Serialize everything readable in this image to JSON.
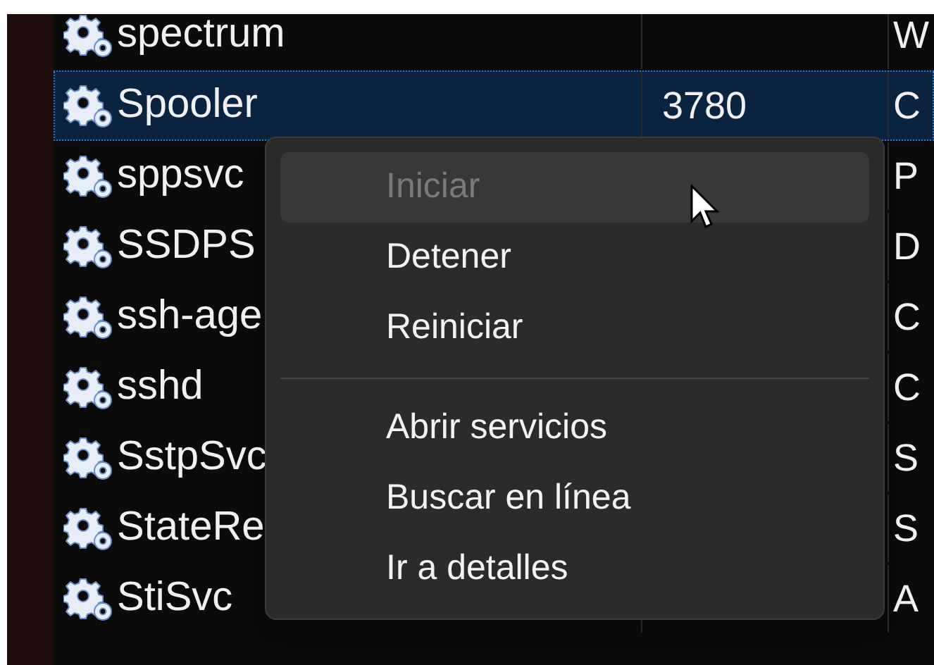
{
  "table": {
    "rows": [
      {
        "name": "spectrum",
        "pid": "",
        "column_3": "W",
        "selected": false
      },
      {
        "name": "Spooler",
        "pid": "3780",
        "column_3": "C",
        "selected": true
      },
      {
        "name": "sppsvc",
        "pid": "",
        "column_3": "P",
        "selected": false
      },
      {
        "name": "SSDPS",
        "pid": "",
        "column_3": "D",
        "selected": false
      },
      {
        "name": "ssh-age",
        "pid": "",
        "column_3": "C",
        "selected": false
      },
      {
        "name": "sshd",
        "pid": "",
        "column_3": "C",
        "selected": false
      },
      {
        "name": "SstpSvc",
        "pid": "",
        "column_3": "S",
        "selected": false
      },
      {
        "name": "StateRe",
        "pid": "",
        "column_3": "S",
        "selected": false
      },
      {
        "name": "StiSvc",
        "pid": "",
        "column_3": "A",
        "selected": false
      }
    ]
  },
  "context_menu": {
    "items": [
      {
        "kind": "item",
        "label": "Iniciar",
        "disabled": true,
        "hovered": true
      },
      {
        "kind": "item",
        "label": "Detener",
        "disabled": false,
        "hovered": false
      },
      {
        "kind": "item",
        "label": "Reiniciar",
        "disabled": false,
        "hovered": false
      },
      {
        "kind": "separator"
      },
      {
        "kind": "item",
        "label": "Abrir servicios",
        "disabled": false,
        "hovered": false
      },
      {
        "kind": "item",
        "label": "Buscar en línea",
        "disabled": false,
        "hovered": false
      },
      {
        "kind": "item",
        "label": "Ir a detalles",
        "disabled": false,
        "hovered": false
      }
    ]
  }
}
